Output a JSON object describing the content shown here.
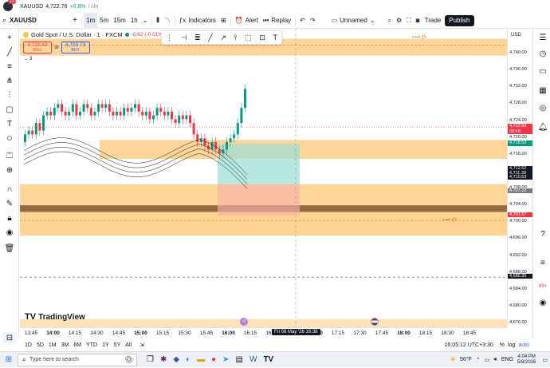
{
  "topbar": {
    "notif_count": "13",
    "symbol_line": "XAUUSD",
    "price": "4,722.76",
    "change": "+0.8%",
    "url_fragment": "/ Un"
  },
  "toolbar": {
    "symbol": "XAUUSD",
    "intervals": [
      "1m",
      "5m",
      "15m",
      "1h"
    ],
    "indicators_label": "Indicators",
    "alert_label": "Alert",
    "replay_label": "Replay",
    "layout_label": "Unnamed",
    "trade_label": "Trade",
    "publish_label": "Publish"
  },
  "legend": {
    "title": "Gold Spot / U.S. Dollar · 1 · FXCM",
    "change": "-0.62 (-0.01%",
    "sell_price": "4,723.43",
    "sell_label": "SELL",
    "spread": "30",
    "buy_price": "4,723.73",
    "buy_label": "BUY",
    "indicator_count": "3"
  },
  "zone_labels": [
    "تاغ شده",
    "تاغ شده"
  ],
  "price_axis": {
    "currency": "USD",
    "ticks": [
      "4,740.00",
      "4,736.00",
      "4,732.00",
      "4,728.00",
      "4,724.00",
      "4,720.00",
      "4,716.00",
      "4,712.00",
      "4,708.00",
      "4,704.00",
      "4,700.00",
      "4,696.00",
      "4,692.00",
      "4,688.00",
      "4,684.00",
      "4,680.00",
      "4,676.00"
    ],
    "tags": [
      {
        "value": "4,722.52",
        "sub": "00:48",
        "color": "#f23645"
      },
      {
        "value": "4,718.53",
        "color": "#089981"
      },
      {
        "value": "4,712.52",
        "color": "#131722"
      },
      {
        "value": "4,711.39",
        "color": "#131722"
      },
      {
        "value": "4,710.53",
        "color": "#131722"
      },
      {
        "value": "4,707.22",
        "color": "#787b86"
      },
      {
        "value": "4,701.57",
        "color": "#f23645"
      },
      {
        "value": "4,686.95",
        "color": "#131722"
      }
    ]
  },
  "time_axis": {
    "ticks": [
      "13:45",
      "14:00",
      "14:15",
      "14:30",
      "14:45",
      "15:00",
      "15:15",
      "15:30",
      "15:45",
      "16:00",
      "16:15",
      "16:30",
      "16:45",
      "17:00",
      "17:15",
      "17:30",
      "17:45",
      "18:00",
      "18:15",
      "18:30",
      "18:45"
    ],
    "crosshair_label": "Fri 08 May '26   16:38"
  },
  "bottombar": {
    "ranges": [
      "1D",
      "5D",
      "1M",
      "3M",
      "6M",
      "YTD",
      "1Y",
      "5Y",
      "All"
    ],
    "clock": "16:05:12 UTC+3:30",
    "watermark": "TradingView"
  },
  "taskbar": {
    "search_placeholder": "Type here to search",
    "weather": "56°F",
    "lang": "ENG",
    "time": "4:04 PM",
    "date": "5/8/2026"
  },
  "colors": {
    "zone_orange": "#ffcf87",
    "zone_dark": "#8a5a2b",
    "long_profit": "#9fe0d4",
    "long_loss": "#f8b0a8",
    "up_candle": "#089981",
    "down_candle": "#f23645",
    "accent": "#2962ff"
  }
}
